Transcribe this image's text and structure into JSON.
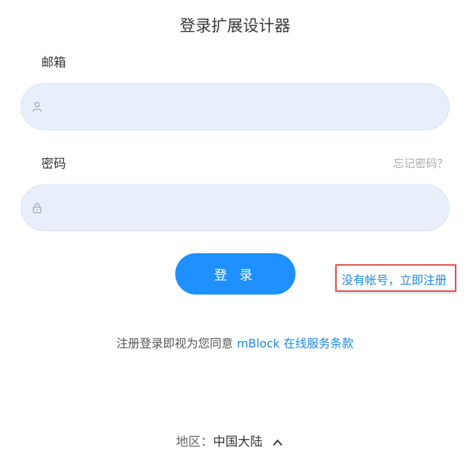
{
  "title": "登录扩展设计器",
  "email": {
    "label": "邮箱",
    "placeholder": "",
    "icon": "user-icon"
  },
  "password": {
    "label": "密码",
    "placeholder": "",
    "icon": "lock-icon",
    "forgot_label": "忘记密码？"
  },
  "login_button_label": "登 录",
  "register_link": "没有帐号，立即注册",
  "terms": {
    "prefix": "注册登录即视为您同意 ",
    "link": "mBlock 在线服务条款"
  },
  "region": {
    "label": "地区：",
    "value": "中国大陆",
    "icon": "chevron-up-icon"
  },
  "colors": {
    "accent": "#1e90ff",
    "input_bg": "#e8effb",
    "highlight_box": "#e14a4a"
  }
}
